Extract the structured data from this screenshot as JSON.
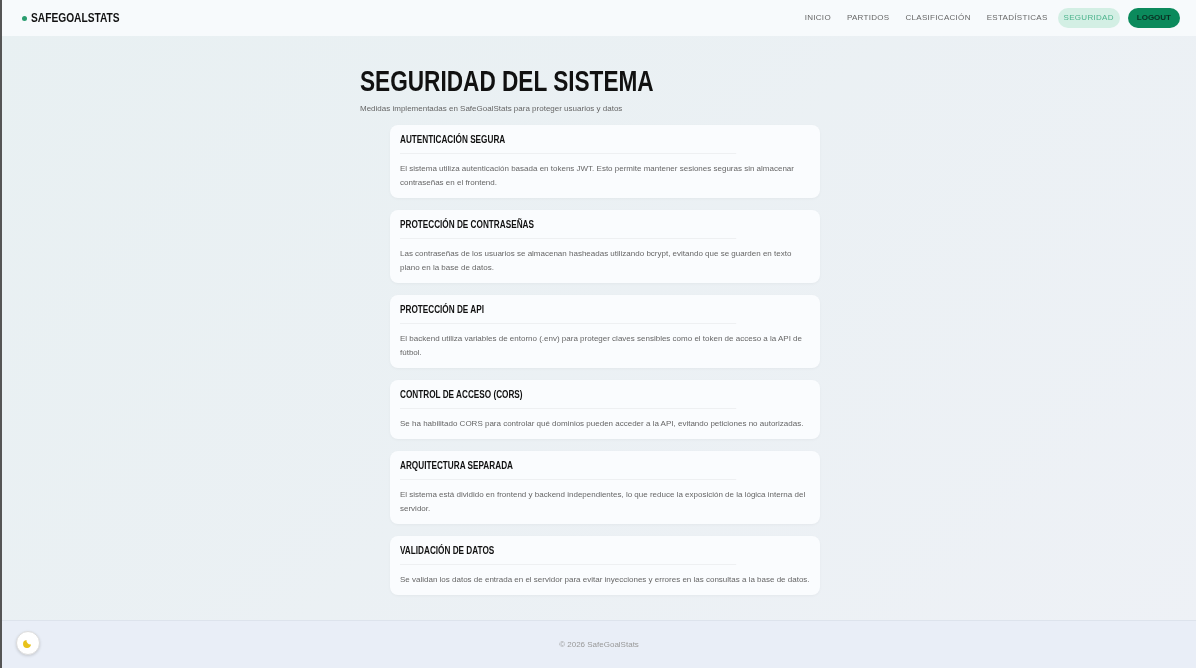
{
  "brand": "SAFEGOALSTATS",
  "nav": [
    {
      "label": "INICIO",
      "selected": false
    },
    {
      "label": "PARTIDOS",
      "selected": false
    },
    {
      "label": "CLASIFICACIÓN",
      "selected": false
    },
    {
      "label": "ESTADÍSTICAS",
      "selected": false
    },
    {
      "label": "SEGURIDAD",
      "selected": true
    }
  ],
  "logout": "LOGOUT",
  "title": "SEGURIDAD DEL SISTEMA",
  "subtitle": "Medidas implementadas en SafeGoalStats para proteger usuarios y datos",
  "cards": [
    {
      "title": "AUTENTICACIÓN SEGURA",
      "text": "El sistema utiliza autenticación basada en tokens JWT. Esto permite mantener sesiones seguras sin almacenar contraseñas en el frontend."
    },
    {
      "title": "PROTECCIÓN DE CONTRASEÑAS",
      "text": "Las contraseñas de los usuarios se almacenan hasheadas utilizando bcrypt, evitando que se guarden en texto plano en la base de datos."
    },
    {
      "title": "PROTECCIÓN DE API",
      "text": "El backend utiliza variables de entorno (.env) para proteger claves sensibles como el token de acceso a la API de fútbol."
    },
    {
      "title": "CONTROL DE ACCESO (CORS)",
      "text": "Se ha habilitado CORS para controlar qué dominios pueden acceder a la API, evitando peticiones no autorizadas."
    },
    {
      "title": "ARQUITECTURA SEPARADA",
      "text": "El sistema está dividido en frontend y backend independientes, lo que reduce la exposición de la lógica interna del servidor."
    },
    {
      "title": "VALIDACIÓN DE DATOS",
      "text": "Se validan los datos de entrada en el servidor para evitar inyecciones y errores en las consultas a la base de datos."
    }
  ],
  "footer": "© 2026 SafeGoalStats"
}
